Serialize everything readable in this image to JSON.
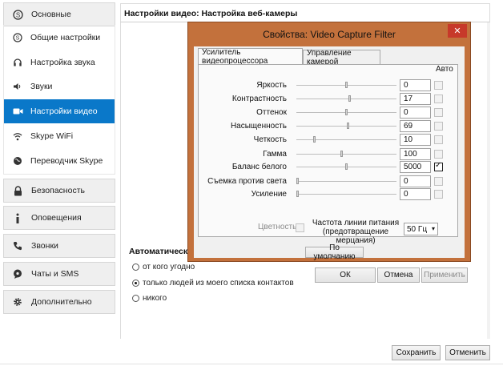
{
  "sidebar": {
    "sections": [
      {
        "label": "Основные",
        "icon": "skype-icon"
      },
      {
        "label": "Безопасность",
        "icon": "lock-icon"
      },
      {
        "label": "Оповещения",
        "icon": "info-icon"
      },
      {
        "label": "Звонки",
        "icon": "phone-icon"
      },
      {
        "label": "Чаты и SMS",
        "icon": "chat-icon"
      },
      {
        "label": "Дополнительно",
        "icon": "gear-icon"
      }
    ],
    "items": [
      {
        "label": "Общие настройки",
        "icon": "skype-icon"
      },
      {
        "label": "Настройка звука",
        "icon": "headset-icon"
      },
      {
        "label": "Звуки",
        "icon": "speaker-icon"
      },
      {
        "label": "Настройки видео",
        "icon": "camera-icon"
      },
      {
        "label": "Skype WiFi",
        "icon": "wifi-icon"
      },
      {
        "label": "Переводчик Skype",
        "icon": "globe-icon"
      }
    ],
    "active_item": "Настройки видео"
  },
  "main": {
    "header": "Настройки видео: Настройка веб-камеры",
    "auto_title": "Автоматически",
    "radio_options": [
      {
        "label": "от кого угодно",
        "selected": false
      },
      {
        "label": "только людей из моего списка контактов",
        "selected": true
      },
      {
        "label": "никого",
        "selected": false
      }
    ]
  },
  "footer": {
    "save_label": "Сохранить",
    "cancel_label": "Отменить"
  },
  "dialog": {
    "title": "Свойства: Video Capture Filter",
    "close_glyph": "✕",
    "tabs": [
      {
        "label": "Усилитель видеопроцессора",
        "selected": true
      },
      {
        "label": "Управление камерой",
        "selected": false
      }
    ],
    "auto_header": "Авто",
    "properties": [
      {
        "label": "Яркость",
        "value": "0",
        "slider": 0.5,
        "auto": false
      },
      {
        "label": "Контрастность",
        "value": "17",
        "slider": 0.53,
        "auto": false
      },
      {
        "label": "Оттенок",
        "value": "0",
        "slider": 0.5,
        "auto": false
      },
      {
        "label": "Насыщенность",
        "value": "69",
        "slider": 0.52,
        "auto": false
      },
      {
        "label": "Четкость",
        "value": "10",
        "slider": 0.17,
        "auto": false
      },
      {
        "label": "Гамма",
        "value": "100",
        "slider": 0.45,
        "auto": false
      },
      {
        "label": "Баланс белого",
        "value": "5000",
        "slider": 0.5,
        "auto": true
      },
      {
        "label": "Съемка против света",
        "value": "0",
        "slider": 0.0,
        "auto": false
      },
      {
        "label": "Усиление",
        "value": "0",
        "slider": 0.0,
        "auto": false
      }
    ],
    "color_label": "Цветность",
    "powerline_label_1": "Частота линии питания",
    "powerline_label_2": "(предотвращение",
    "powerline_label_3": "мерцания)",
    "powerline_value": "50 Гц",
    "default_button": "По умолчанию",
    "ok_button": "ОК",
    "cancel_button": "Отмена",
    "apply_button": "Применить"
  }
}
